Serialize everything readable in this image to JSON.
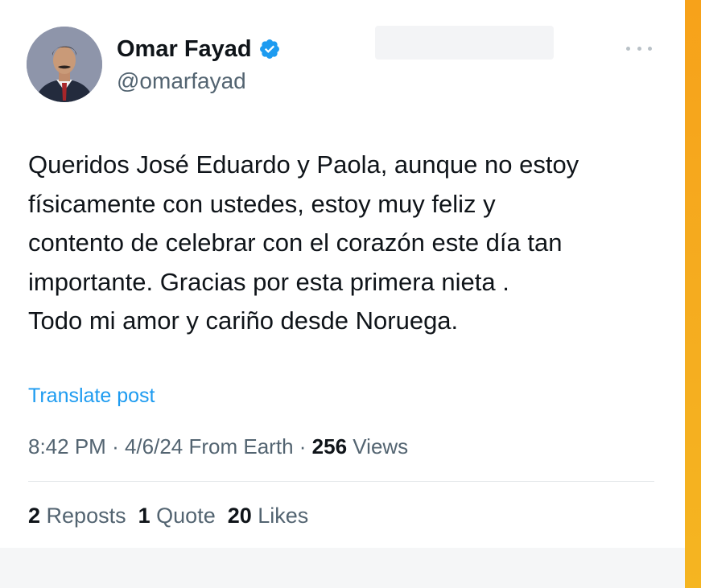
{
  "author": {
    "display_name": "Omar Fayad",
    "handle": "@omarfayad",
    "verified": true
  },
  "tweet": {
    "lines": [
      "Queridos José Eduardo y Paola, aunque no estoy",
      "físicamente con ustedes, estoy muy feliz y",
      "contento de celebrar con el corazón este día tan",
      "importante. Gracias por esta primera nieta .",
      "Todo mi amor y cariño desde Noruega."
    ]
  },
  "translate_label": "Translate post",
  "meta": {
    "time": "8:42 PM",
    "separator": "·",
    "date": "4/6/24",
    "source": "From Earth",
    "views_count": "256",
    "views_label": "Views"
  },
  "stats": {
    "reposts_count": "2",
    "reposts_label": "Reposts",
    "quotes_count": "1",
    "quotes_label": "Quote",
    "likes_count": "20",
    "likes_label": "Likes"
  },
  "icons": {
    "verified": "verified-badge-icon",
    "more": "more-options-icon"
  },
  "colors": {
    "accent": "#1d9bf0",
    "text": "#0f1419",
    "secondary_text": "#536471",
    "side_stripe": "#f7a21a"
  }
}
